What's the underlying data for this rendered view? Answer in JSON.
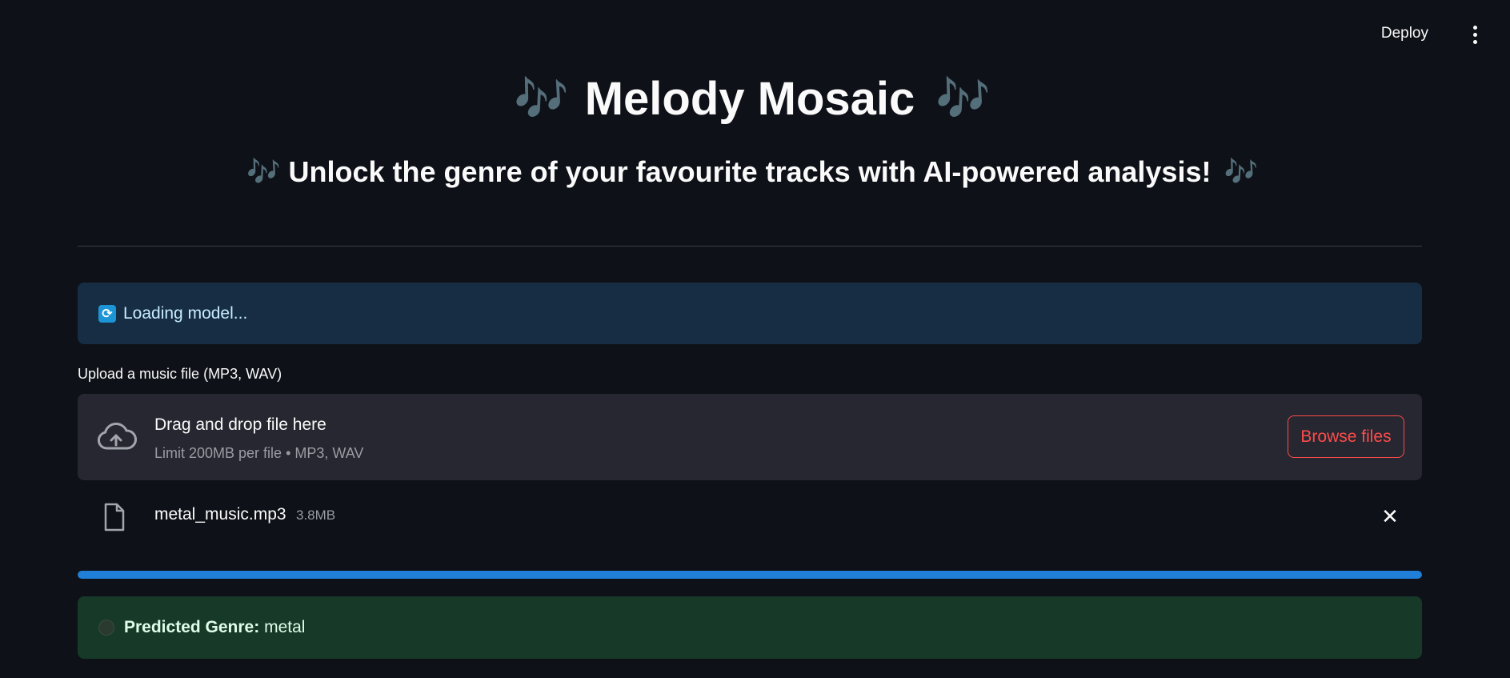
{
  "header": {
    "deploy_label": "Deploy",
    "menu_icon": "kebab-menu-icon"
  },
  "title": {
    "text": "Melody Mosaic",
    "decor_icon": "musical-notes-icon",
    "decor_glyph": "🎶"
  },
  "subtitle": {
    "text": "Unlock the genre of your favourite tracks with AI-powered analysis!",
    "decor_glyph": "🎶"
  },
  "info": {
    "icon": "refresh-icon",
    "icon_glyph": "⟳",
    "text": "Loading model..."
  },
  "uploader": {
    "label": "Upload a music file (MP3, WAV)",
    "drop_title": "Drag and drop file here",
    "drop_limit": "Limit 200MB per file • MP3, WAV",
    "browse_label": "Browse files",
    "icon": "cloud-upload-icon"
  },
  "file": {
    "name": "metal_music.mp3",
    "size": "3.8MB",
    "icon": "file-icon",
    "remove_glyph": "✕"
  },
  "progress": {
    "value": 1.0,
    "color": "#1f7fd9"
  },
  "result": {
    "label": "Predicted Genre:",
    "value": "metal",
    "icon": "check-circle-icon"
  },
  "colors": {
    "background": "#0e1117",
    "accent": "#ff4b4b",
    "info_bg": "#172d43",
    "success_bg": "#173928"
  }
}
